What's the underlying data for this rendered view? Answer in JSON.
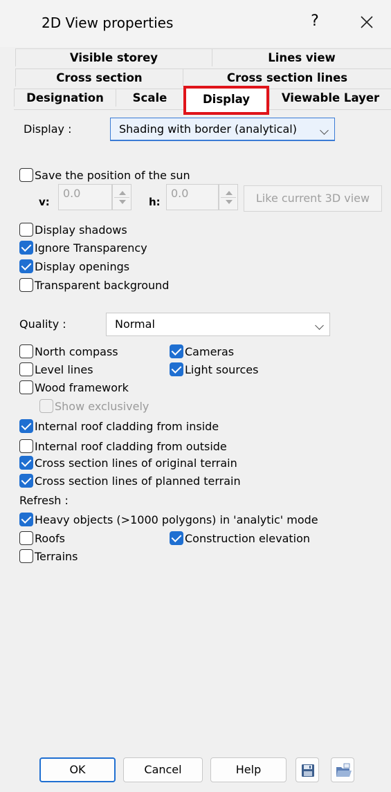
{
  "window": {
    "title": "2D View properties",
    "help_label": "?",
    "close_icon": "close-icon"
  },
  "tabs": {
    "row1": [
      "Visible storey",
      "Lines view"
    ],
    "row2": [
      "Cross section",
      "Cross section lines"
    ],
    "row3": [
      "Designation",
      "Scale",
      "Display",
      "Viewable Layer"
    ],
    "active": "Display"
  },
  "display": {
    "label": "Display :",
    "value": "Shading with border (analytical)"
  },
  "sun": {
    "label": "Save the position of the sun",
    "checked": false,
    "v_label": "v:",
    "v_value": "0.0",
    "h_label": "h:",
    "h_value": "0.0",
    "like_3d_label": "Like current 3D view"
  },
  "options": [
    {
      "label": "Display shadows",
      "checked": false
    },
    {
      "label": "Ignore Transparency",
      "checked": true
    },
    {
      "label": "Display openings",
      "checked": true
    },
    {
      "label": "Transparent background",
      "checked": false
    }
  ],
  "quality": {
    "label": "Quality :",
    "value": "Normal"
  },
  "elements": {
    "north_compass": {
      "label": "North compass",
      "checked": false
    },
    "cameras": {
      "label": "Cameras",
      "checked": true
    },
    "level_lines": {
      "label": "Level lines",
      "checked": false
    },
    "light_sources": {
      "label": "Light sources",
      "checked": true
    },
    "wood_framework": {
      "label": "Wood framework",
      "checked": false
    },
    "show_exclusively": {
      "label": "Show exclusively",
      "checked": false,
      "disabled": true
    },
    "roof_inside": {
      "label": "Internal roof cladding from inside",
      "checked": true
    },
    "roof_outside": {
      "label": "Internal roof cladding from outside",
      "checked": false
    },
    "terrain_original": {
      "label": "Cross section lines of original terrain",
      "checked": true
    },
    "terrain_planned": {
      "label": "Cross section lines of planned terrain",
      "checked": true
    }
  },
  "refresh": {
    "label": "Refresh :",
    "heavy_objects": {
      "label": "Heavy objects (>1000 polygons) in 'analytic' mode",
      "checked": true
    },
    "roofs": {
      "label": "Roofs",
      "checked": false
    },
    "construction_elevation": {
      "label": "Construction elevation",
      "checked": true
    },
    "terrains": {
      "label": "Terrains",
      "checked": false
    }
  },
  "footer": {
    "ok": "OK",
    "cancel": "Cancel",
    "help": "Help",
    "save_icon": "save-icon",
    "open_icon": "open-folder-icon"
  },
  "colors": {
    "accent": "#1f6fd1",
    "active_tab_border": "#e0141a"
  }
}
